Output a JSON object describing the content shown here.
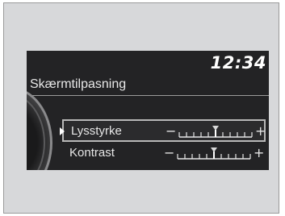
{
  "screen": {
    "clock": "12:34",
    "title": "Skærmtilpasning"
  },
  "settings": [
    {
      "label": "Lysstyrke",
      "selected": true,
      "level": 0.5
    },
    {
      "label": "Kontrast",
      "selected": false,
      "level": 0.5
    }
  ],
  "controls": {
    "minus_symbol": "−",
    "plus_symbol": "+"
  },
  "scale": {
    "ticks": 11
  }
}
